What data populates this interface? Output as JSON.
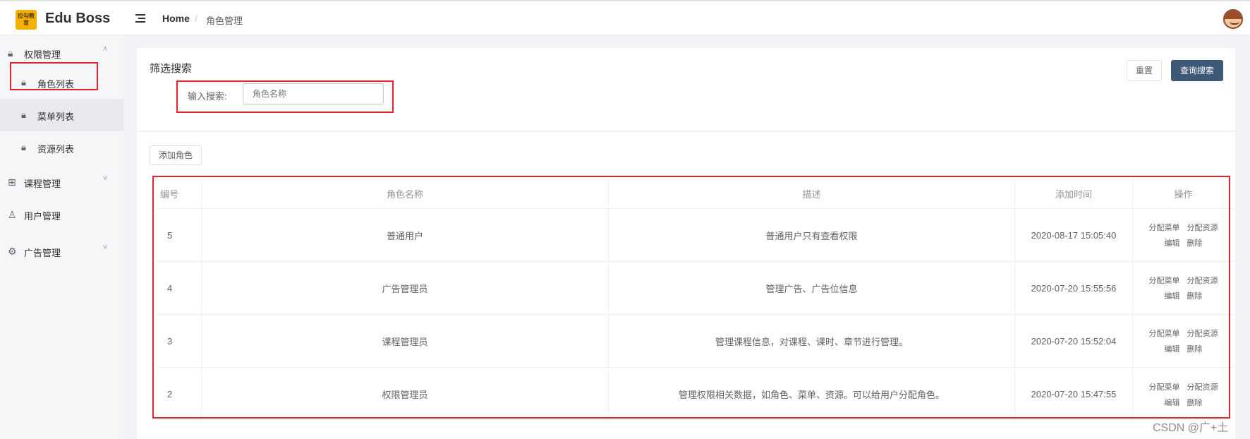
{
  "header": {
    "logo_text": "拉勾教育",
    "app_title": "Edu Boss",
    "breadcrumb_home": "Home",
    "breadcrumb_sep": "/",
    "breadcrumb_current": "角色管理"
  },
  "sidebar": {
    "groups": [
      {
        "label": "权限管理",
        "icon": "lock-icon",
        "expanded": true
      },
      {
        "label": "课程管理",
        "icon": "grid-icon"
      },
      {
        "label": "用户管理",
        "icon": "user-icon"
      },
      {
        "label": "广告管理",
        "icon": "gear-icon"
      }
    ],
    "sub_items": [
      {
        "label": "角色列表",
        "icon": "lock-icon",
        "active": true
      },
      {
        "label": "菜单列表",
        "icon": "lock-icon"
      },
      {
        "label": "资源列表",
        "icon": "lock-icon"
      }
    ]
  },
  "filter": {
    "title": "筛选搜索",
    "search_label": "输入搜索:",
    "search_placeholder": "角色名称",
    "search_value": "",
    "reset_label": "重置",
    "search_button_label": "查询搜索"
  },
  "actions": {
    "add_role_label": "添加角色"
  },
  "table": {
    "columns": [
      "编号",
      "角色名称",
      "描述",
      "添加时间",
      "操作"
    ],
    "rows": [
      {
        "id": "5",
        "name": "普通用户",
        "desc": "普通用户只有查看权限",
        "time": "2020-08-17 15:05:40"
      },
      {
        "id": "4",
        "name": "广告管理员",
        "desc": "管理广告、广告位信息",
        "time": "2020-07-20 15:55:56"
      },
      {
        "id": "3",
        "name": "课程管理员",
        "desc": "管理课程信息，对课程、课时、章节进行管理。",
        "time": "2020-07-20 15:52:04"
      },
      {
        "id": "2",
        "name": "权限管理员",
        "desc": "管理权限相关数据，如角色、菜单、资源。可以给用户分配角色。",
        "time": "2020-07-20 15:47:55"
      }
    ],
    "row_ops": {
      "assign_menu": "分配菜单",
      "assign_resource": "分配资源",
      "edit": "编辑",
      "delete": "删除"
    }
  },
  "watermark": "CSDN @广+土",
  "colors": {
    "primary_button": "#3e5877",
    "annotation_red": "#e8222a",
    "sidebar_bg": "#f5f6f8",
    "main_bg": "#f0f2f5"
  }
}
